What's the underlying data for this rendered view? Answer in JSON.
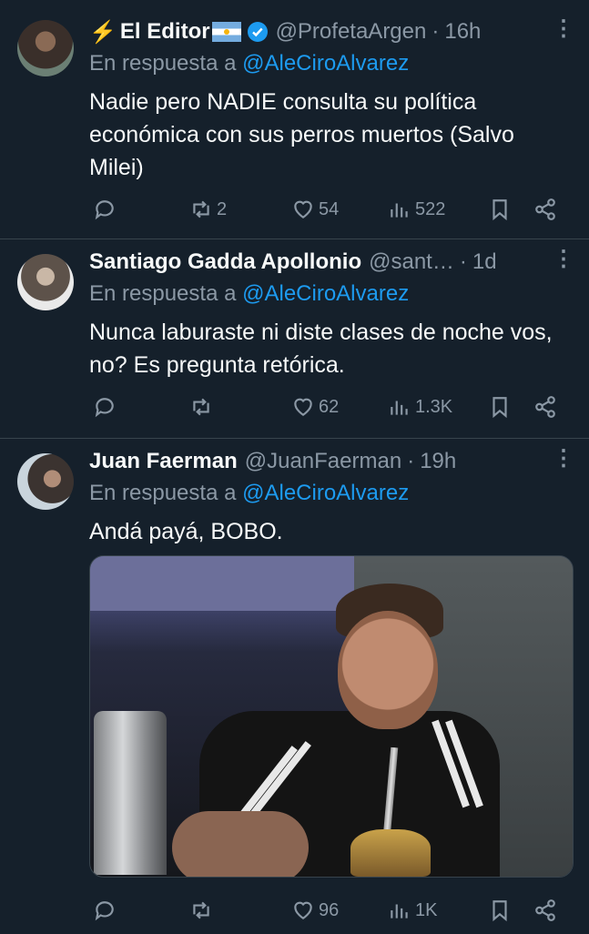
{
  "tweets": [
    {
      "name": "El Editor",
      "handle": "@ProfetaArgen",
      "time": "16h",
      "reply_label": "En respuesta a",
      "reply_to": "@AleCiroAlvarez",
      "text": "Nadie pero NADIE consulta su política económica con sus perros muertos (Salvo Milei)",
      "replies": "",
      "retweets": "2",
      "likes": "54",
      "views": "522"
    },
    {
      "name": "Santiago Gadda Apollonio",
      "handle": "@sant…",
      "time": "1d",
      "reply_label": "En respuesta a",
      "reply_to": "@AleCiroAlvarez",
      "text": "Nunca laburaste ni diste clases de noche vos, no? Es pregunta retórica.",
      "replies": "",
      "retweets": "",
      "likes": "62",
      "views": "1.3K"
    },
    {
      "name": "Juan Faerman",
      "handle": "@JuanFaerman",
      "time": "19h",
      "reply_label": "En respuesta a",
      "reply_to": "@AleCiroAlvarez",
      "text": "Andá payá, BOBO.",
      "replies": "",
      "retweets": "",
      "likes": "96",
      "views": "1K"
    }
  ],
  "sep": "·",
  "colors": {
    "bg": "#15202b",
    "accent": "#1d9bf0",
    "muted": "#8b98a5",
    "border": "#38444d"
  }
}
